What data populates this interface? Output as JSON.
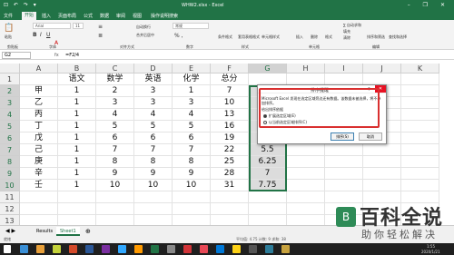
{
  "window": {
    "title": "WHW2.xlsx - Excel",
    "quick_access": "⊡ ↶ ↷ ▾",
    "controls": "– ❐ ✕"
  },
  "tabs": [
    "文件",
    "开始",
    "插入",
    "页面布局",
    "公式",
    "数据",
    "审阅",
    "视图",
    "操作说明搜索"
  ],
  "ribbon": {
    "paste": "粘贴",
    "clipboard": "剪贴板",
    "font_name": "Arial",
    "font_size": "11",
    "font_group": "字体",
    "align_group": "对齐方式",
    "wrap_text": "自动换行",
    "merge_center": "合并后居中",
    "number_format": "常规",
    "number_group": "数字",
    "cond_format": "条件格式",
    "table_format": "套用表格格式",
    "cell_styles": "单元格样式",
    "styles_group": "样式",
    "insert": "插入",
    "delete": "删除",
    "format": "格式",
    "cells_group": "单元格",
    "autosum": "∑ 自动求和",
    "fill": "填充",
    "clear": "清除",
    "sort_filter": "排序和筛选",
    "find_select": "查找和选择",
    "edit_group": "编辑"
  },
  "formula_bar": {
    "name_box": "G2",
    "fx": "fx",
    "formula": "=F2/4"
  },
  "columns": [
    "A",
    "B",
    "C",
    "D",
    "E",
    "F",
    "G",
    "H",
    "I",
    "J",
    "K"
  ],
  "rows": [
    [
      "",
      "语文",
      "数学",
      "英语",
      "化学",
      "总分",
      "",
      "",
      "",
      "",
      ""
    ],
    [
      "甲",
      "1",
      "2",
      "3",
      "1",
      "7",
      "",
      "",
      "",
      "",
      ""
    ],
    [
      "乙",
      "1",
      "3",
      "3",
      "3",
      "10",
      "",
      "",
      "",
      "",
      ""
    ],
    [
      "丙",
      "1",
      "4",
      "4",
      "4",
      "13",
      "",
      "",
      "",
      "",
      ""
    ],
    [
      "丁",
      "1",
      "5",
      "5",
      "5",
      "16",
      "",
      "",
      "",
      "",
      ""
    ],
    [
      "戊",
      "1",
      "6",
      "6",
      "6",
      "19",
      "",
      "",
      "",
      "",
      ""
    ],
    [
      "己",
      "1",
      "7",
      "7",
      "7",
      "22",
      "5.5",
      "",
      "",
      "",
      ""
    ],
    [
      "庚",
      "1",
      "8",
      "8",
      "8",
      "25",
      "6.25",
      "",
      "",
      "",
      ""
    ],
    [
      "辛",
      "1",
      "9",
      "9",
      "9",
      "28",
      "7",
      "",
      "",
      "",
      ""
    ],
    [
      "壬",
      "1",
      "10",
      "10",
      "10",
      "31",
      "7.75",
      "",
      "",
      "",
      ""
    ],
    [
      "",
      "",
      "",
      "",
      "",
      "",
      "",
      "",
      "",
      "",
      ""
    ],
    [
      "",
      "",
      "",
      "",
      "",
      "",
      "",
      "",
      "",
      "",
      ""
    ],
    [
      "",
      "",
      "",
      "",
      "",
      "",
      "",
      "",
      "",
      "",
      ""
    ]
  ],
  "sheets": [
    "Results",
    "Sheet1"
  ],
  "status": {
    "left": "就绪",
    "right": "平均值: 4.75   计数: 9   求和: 38"
  },
  "dialog": {
    "title": "排序提醒",
    "help": "?",
    "close": "✕",
    "message": "Microsoft Excel 发现在选定区域旁边还有数据。该数据未被选择，将不参加排序。",
    "subtitle": "给出排序依据",
    "option_expand": "扩展选定区域(E)",
    "option_current": "以当前选定区域排序(C)",
    "sort_button": "排序(S)",
    "cancel_button": "取消"
  },
  "taskbar": {
    "time": "1:55",
    "date": "2020/1/21"
  },
  "watermark": {
    "title": "百科全说",
    "subtitle": "助你轻松解决"
  }
}
